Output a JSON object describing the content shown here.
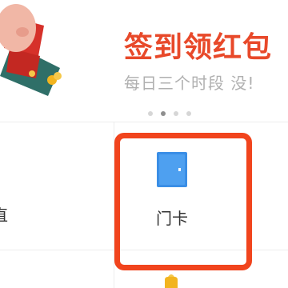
{
  "banner": {
    "title": "签到领红包",
    "subtitle": "每日三个时段 没!"
  },
  "carousel": {
    "dot_count": 4,
    "active_index": 1
  },
  "grid": {
    "left_cell_label_partial": "直",
    "door_card_label": "门卡"
  },
  "colors": {
    "title_red": "#e8492a",
    "subtitle_gray": "#b0b0b0",
    "highlight_border": "#f1441d",
    "card_icon_blue": "#3a8ee6",
    "banner_teal": "#2f6f68",
    "banner_pig_pink": "#f1b7a6",
    "banner_red": "#d6312a",
    "banner_gold": "#f2b41f"
  },
  "icons": {
    "banner_art": "piggy-envelope-icon",
    "door_card": "door-card-icon",
    "pointer": "hand-pointer-icon"
  }
}
